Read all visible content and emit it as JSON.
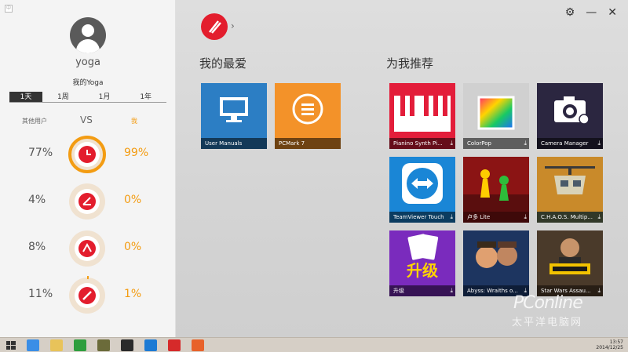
{
  "profile": {
    "username": "yoga",
    "subtitle": "我的Yoga"
  },
  "periods": [
    "1天",
    "1周",
    "1月",
    "1年"
  ],
  "compare": {
    "others_label": "其他用户",
    "vs_label": "VS",
    "me_label": "我"
  },
  "stats": [
    {
      "others": "77%",
      "mine": "99%",
      "icon": "clock-icon",
      "mine_fraction": 0.99
    },
    {
      "others": "4%",
      "mine": "0%",
      "icon": "lenovo-e-icon",
      "mine_fraction": 0.0
    },
    {
      "others": "8%",
      "mine": "0%",
      "icon": "arrow-up-icon",
      "mine_fraction": 0.0
    },
    {
      "others": "11%",
      "mine": "1%",
      "icon": "pen-icon",
      "mine_fraction": 0.01
    }
  ],
  "window": {
    "settings_icon": "⚙",
    "minimize_icon": "—",
    "close_icon": "✕",
    "logo_chevron": "›"
  },
  "favorites": {
    "title": "我的最爱",
    "items": [
      {
        "label": "User Manuals",
        "color": "#2c7ec4"
      },
      {
        "label": "PCMark 7",
        "color": "#f39229"
      }
    ]
  },
  "recommend": {
    "title": "为我推荐",
    "items": [
      {
        "label": "Pianino Synth Pi...",
        "color": "#e31d3a"
      },
      {
        "label": "ColorPop",
        "color": "#cfcfcf"
      },
      {
        "label": "Camera Manager",
        "color": "#2b2640"
      },
      {
        "label": "TeamViewer Touch",
        "color": "#1a86d6"
      },
      {
        "label": "卢多 Lite",
        "color": "#8b1414"
      },
      {
        "label": "C.H.A.O.S. Multip...",
        "color": "#6e7d5a"
      },
      {
        "label": "升级",
        "color": "#7a2bbd"
      },
      {
        "label": "Abyss: Wraiths o...",
        "color": "#20427a"
      },
      {
        "label": "Star Wars Assau...",
        "color": "#5a4330"
      }
    ],
    "download_icon": "⤓"
  },
  "watermark": {
    "line1": "PConline",
    "line2": "太平洋电脑网"
  },
  "taskbar": {
    "time": "13:57",
    "date": "2014/12/25"
  }
}
